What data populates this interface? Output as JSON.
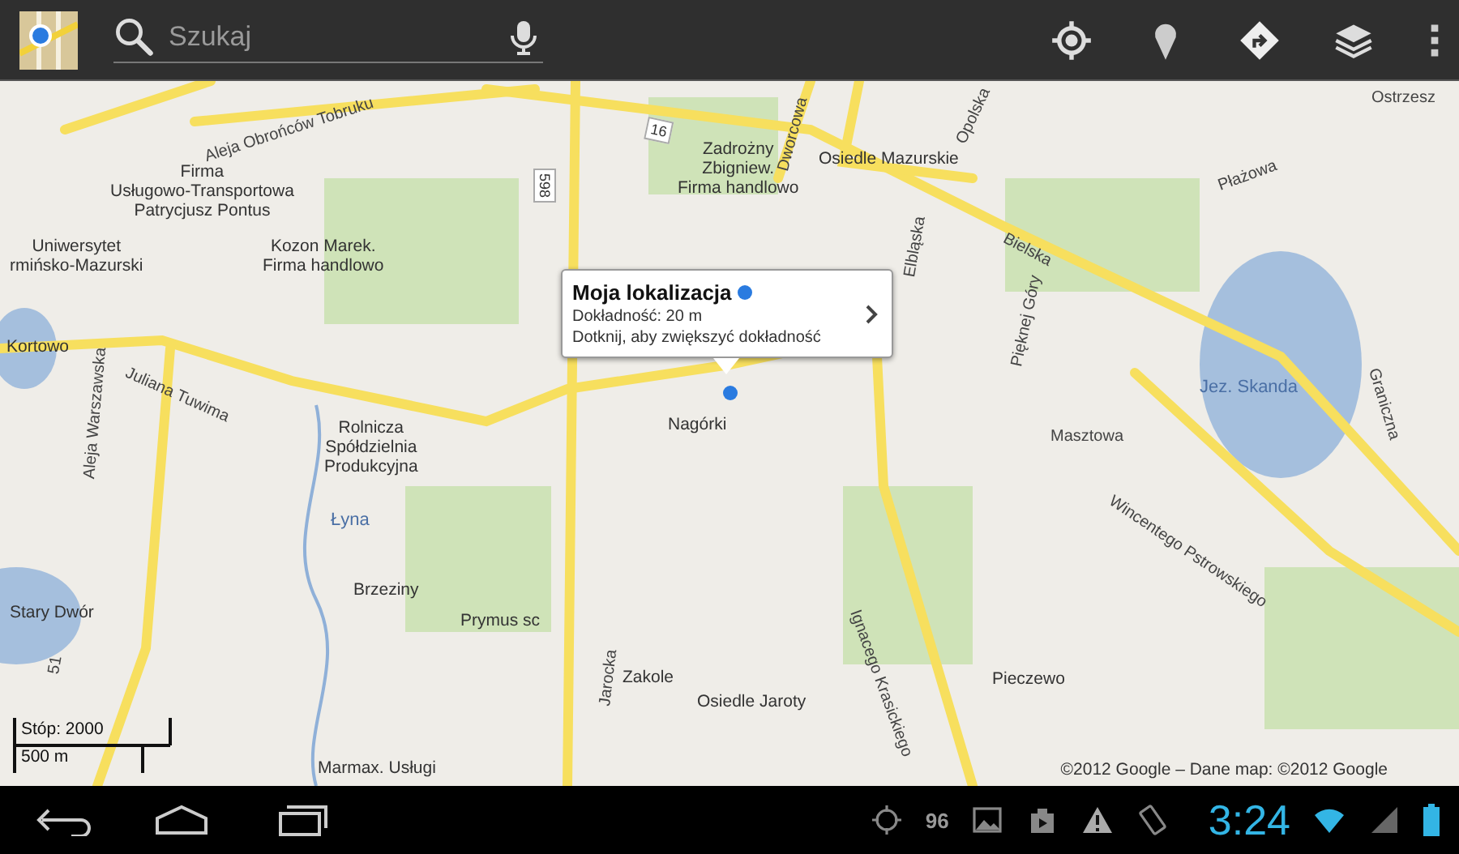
{
  "top_bar": {
    "search": {
      "placeholder": "Szukaj"
    }
  },
  "map": {
    "labels": [
      {
        "text": "Aleja Obrońców Tobruku",
        "kind": "road"
      },
      {
        "text": "16",
        "kind": "shield"
      },
      {
        "text": "Dworcowa",
        "kind": "road"
      },
      {
        "text": "Opolska",
        "kind": "road"
      },
      {
        "text": "Ostrzesz",
        "kind": "road"
      },
      {
        "text": "Firma\nUsługowo-Transportowa\nPatrycjusz Pontus",
        "kind": "place"
      },
      {
        "text": "598",
        "kind": "shield"
      },
      {
        "text": "Zadrożny\nZbigniew.\nFirma handlowo",
        "kind": "place"
      },
      {
        "text": "Osiedle Mazurskie",
        "kind": "place"
      },
      {
        "text": "Bielska",
        "kind": "road"
      },
      {
        "text": "Płażowa",
        "kind": "road"
      },
      {
        "text": "Uniwersytet\nrmińsko-Mazurski",
        "kind": "place"
      },
      {
        "text": "Kozon Marek.\nFirma handlowo",
        "kind": "place"
      },
      {
        "text": "Kortowo",
        "kind": "place"
      },
      {
        "text": "Juliana Tuwima",
        "kind": "road"
      },
      {
        "text": "Elbląska",
        "kind": "road"
      },
      {
        "text": "Pięknej Góry",
        "kind": "road"
      },
      {
        "text": "Jez. Skanda",
        "kind": "water"
      },
      {
        "text": "Graniczna",
        "kind": "road"
      },
      {
        "text": "Aleja Warszawska",
        "kind": "road"
      },
      {
        "text": "Nagórki",
        "kind": "place"
      },
      {
        "text": "Masztowa",
        "kind": "road"
      },
      {
        "text": "Wincentego Pstrowskiego",
        "kind": "road"
      },
      {
        "text": "Rolnicza\nSpółdzielnia\nProdukcyjna",
        "kind": "place"
      },
      {
        "text": "Łyna",
        "kind": "water"
      },
      {
        "text": "Ignacego Krasickiego",
        "kind": "road"
      },
      {
        "text": "Brzeziny",
        "kind": "place"
      },
      {
        "text": "Stary Dwór",
        "kind": "place"
      },
      {
        "text": "Prymus sc",
        "kind": "place"
      },
      {
        "text": "51",
        "kind": "road"
      },
      {
        "text": "Zakole",
        "kind": "place"
      },
      {
        "text": "Osiedle Jaroty",
        "kind": "place"
      },
      {
        "text": "Jarocka",
        "kind": "road"
      },
      {
        "text": "Pieczewo",
        "kind": "place"
      },
      {
        "text": "Marmax. Usługi",
        "kind": "place"
      }
    ],
    "info_window": {
      "title": "Moja lokalizacja",
      "accuracy": "Dokładność: 20 m",
      "hint": "Dotknij, aby zwiększyć dokładność"
    },
    "scale": {
      "feet": "Stóp: 2000",
      "meters": "500 m"
    },
    "attribution": "©2012 Google – Dane map: ©2012 Google"
  },
  "status_bar": {
    "notification_count": "96",
    "clock": "3:24"
  }
}
